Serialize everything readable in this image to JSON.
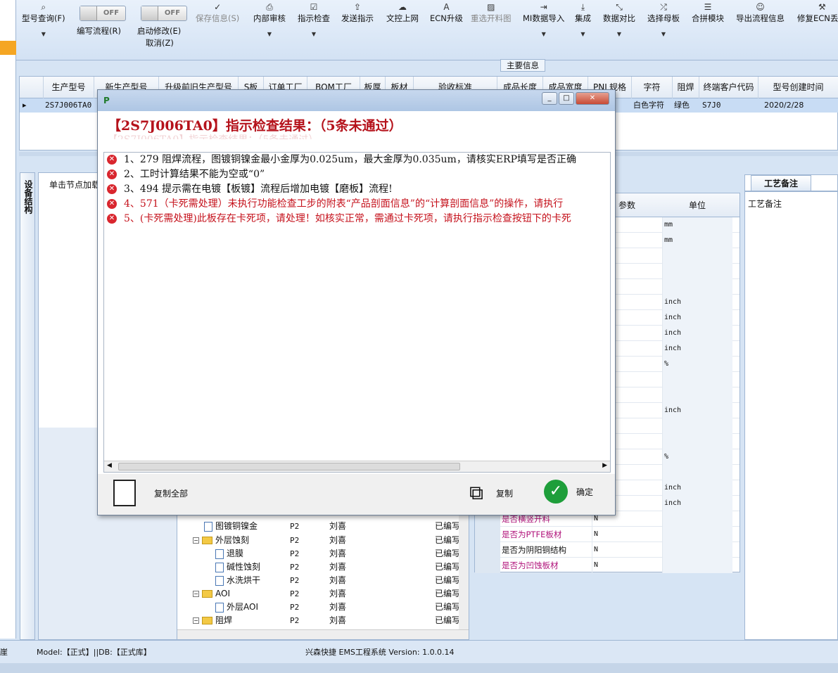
{
  "ribbon": {
    "query": "型号查询(F)",
    "write_flow": "编写流程(R)",
    "write_flow_toggle": "OFF",
    "start_modify": "启动修改(E)",
    "start_modify_toggle": "OFF",
    "cancel": "取消(Z)",
    "save": "保存信息(S)",
    "internal_review": "内部审核",
    "instruction_check": "指示检查",
    "send_instruction": "发送指示",
    "doc_upload": "文控上网",
    "ecn_upgrade": "ECN升级",
    "reselect_cut": "重选开料图",
    "mi_import": "MI数据导入",
    "integrate": "集成",
    "data_compare": "数据对比",
    "select_master": "选择母板",
    "panel_module": "合拼模块",
    "export_flow": "导出流程信息",
    "repair_ecn": "修复ECN丢"
  },
  "main_info_label": "主要信息",
  "grid": {
    "columns": [
      "生产型号",
      "新生产型号",
      "升级前旧生产型号",
      "S板",
      "订单工厂",
      "BOM工厂",
      "板厚",
      "板材",
      "验收标准",
      "成品长度",
      "成品宽度",
      "PNL规格",
      "字符",
      "阻焊",
      "终端客户代码",
      "型号创建时间"
    ],
    "row": {
      "model": "2S7J006TA0",
      "char": "白色字符",
      "mask": "绿色",
      "cust": "S7J0",
      "created": "2020/2/28"
    }
  },
  "left": {
    "tab": "设备结构",
    "hint": "单击节点加载"
  },
  "tree": {
    "rows": [
      {
        "name": "图镀铜镍金",
        "code": "P2",
        "user": "刘喜",
        "status": "已编写"
      },
      {
        "name": "外层蚀刻",
        "code": "P2",
        "user": "刘喜",
        "status": "已编写"
      },
      {
        "name": "退膜",
        "code": "P2",
        "user": "刘喜",
        "status": "已编写"
      },
      {
        "name": "碱性蚀刻",
        "code": "P2",
        "user": "刘喜",
        "status": "已编写"
      },
      {
        "name": "水洗烘干",
        "code": "P2",
        "user": "刘喜",
        "status": "已编写"
      },
      {
        "name": "AOI",
        "code": "P2",
        "user": "刘喜",
        "status": "已编写"
      },
      {
        "name": "外层AOI",
        "code": "P2",
        "user": "刘喜",
        "status": "已编写"
      },
      {
        "name": "阻焊",
        "code": "P2",
        "user": "刘喜",
        "status": "已编写"
      }
    ]
  },
  "props": {
    "col_param": "参数",
    "col_unit": "单位",
    "units": [
      "mm",
      "mm",
      "",
      "",
      "",
      "inch",
      "inch",
      "inch",
      "inch",
      "%",
      "",
      "",
      "inch",
      "",
      "",
      "%",
      "",
      "inch",
      "inch"
    ],
    "rows": [
      {
        "name": "是否横竖开料",
        "value": "N",
        "pink": true
      },
      {
        "name": "是否为PTFE板材",
        "value": "N",
        "pink": true
      },
      {
        "name": "是否为阴阳铜结构",
        "value": "N",
        "pink": false
      },
      {
        "name": "是否为凹蚀板材",
        "value": "N",
        "pink": true
      }
    ]
  },
  "right": {
    "tab": "工艺备注",
    "label": "工艺备注"
  },
  "status": {
    "left_edge": "崖",
    "model_db": "Model:【正式】||DB:【正式库】",
    "system": "兴森快捷 EMS工程系统 Version: 1.0.0.14"
  },
  "dialog": {
    "title": "【2S7J006TA0】指示检查结果：（5条未通过）",
    "items": [
      {
        "text": "1、279 阻焊流程，图镀铜镍金最小金厚为0.025um，最大金厚为0.035um，请核实ERP填写是否正确",
        "red": false
      },
      {
        "text": "2、工时计算结果不能为空或“0”",
        "red": false
      },
      {
        "text": "3、494 提示需在电镀【板镀】流程后增加电镀【磨板】流程!",
        "red": false
      },
      {
        "text": "4、571（卡死需处理）未执行功能检查工步的附表“产品剖面信息”的“计算剖面信息”的操作，请执行",
        "red": true
      },
      {
        "text": "5、(卡死需处理)此板存在卡死项，请处理！如核实正常，需通过卡死项，请执行指示检查按钮下的卡死",
        "red": true
      }
    ],
    "copy_all": "复制全部",
    "copy": "复制",
    "ok": "确定"
  }
}
